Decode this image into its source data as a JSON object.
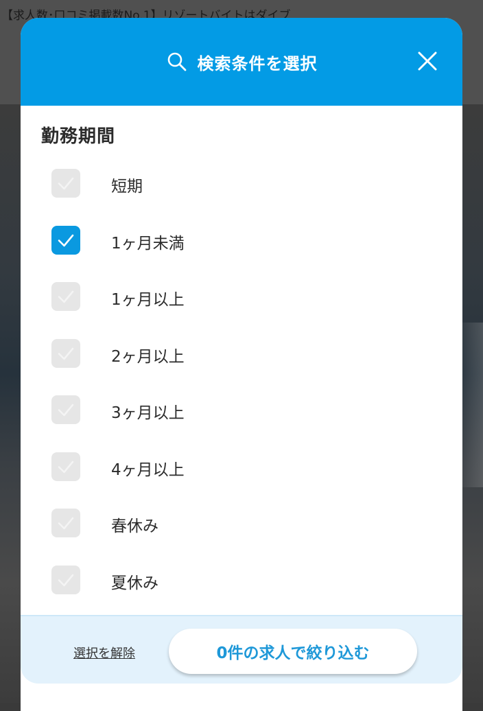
{
  "background": {
    "header_text": "【求人数･口コミ掲載数No.1】リゾートバイトはダイブ"
  },
  "modal": {
    "title": "検索条件を選択",
    "accent_color": "#039be5",
    "icons": {
      "search": "search-icon",
      "close": "close-icon",
      "check": "check-icon"
    },
    "section_title": "勤務期間",
    "options": [
      {
        "label": "短期",
        "checked": false
      },
      {
        "label": "1ヶ月未満",
        "checked": true
      },
      {
        "label": "1ヶ月以上",
        "checked": false
      },
      {
        "label": "2ヶ月以上",
        "checked": false
      },
      {
        "label": "3ヶ月以上",
        "checked": false
      },
      {
        "label": "4ヶ月以上",
        "checked": false
      },
      {
        "label": "春休み",
        "checked": false
      },
      {
        "label": "夏休み",
        "checked": false
      }
    ],
    "footer": {
      "clear_label": "選択を解除",
      "apply_label": "0件の求人で絞り込む"
    }
  }
}
